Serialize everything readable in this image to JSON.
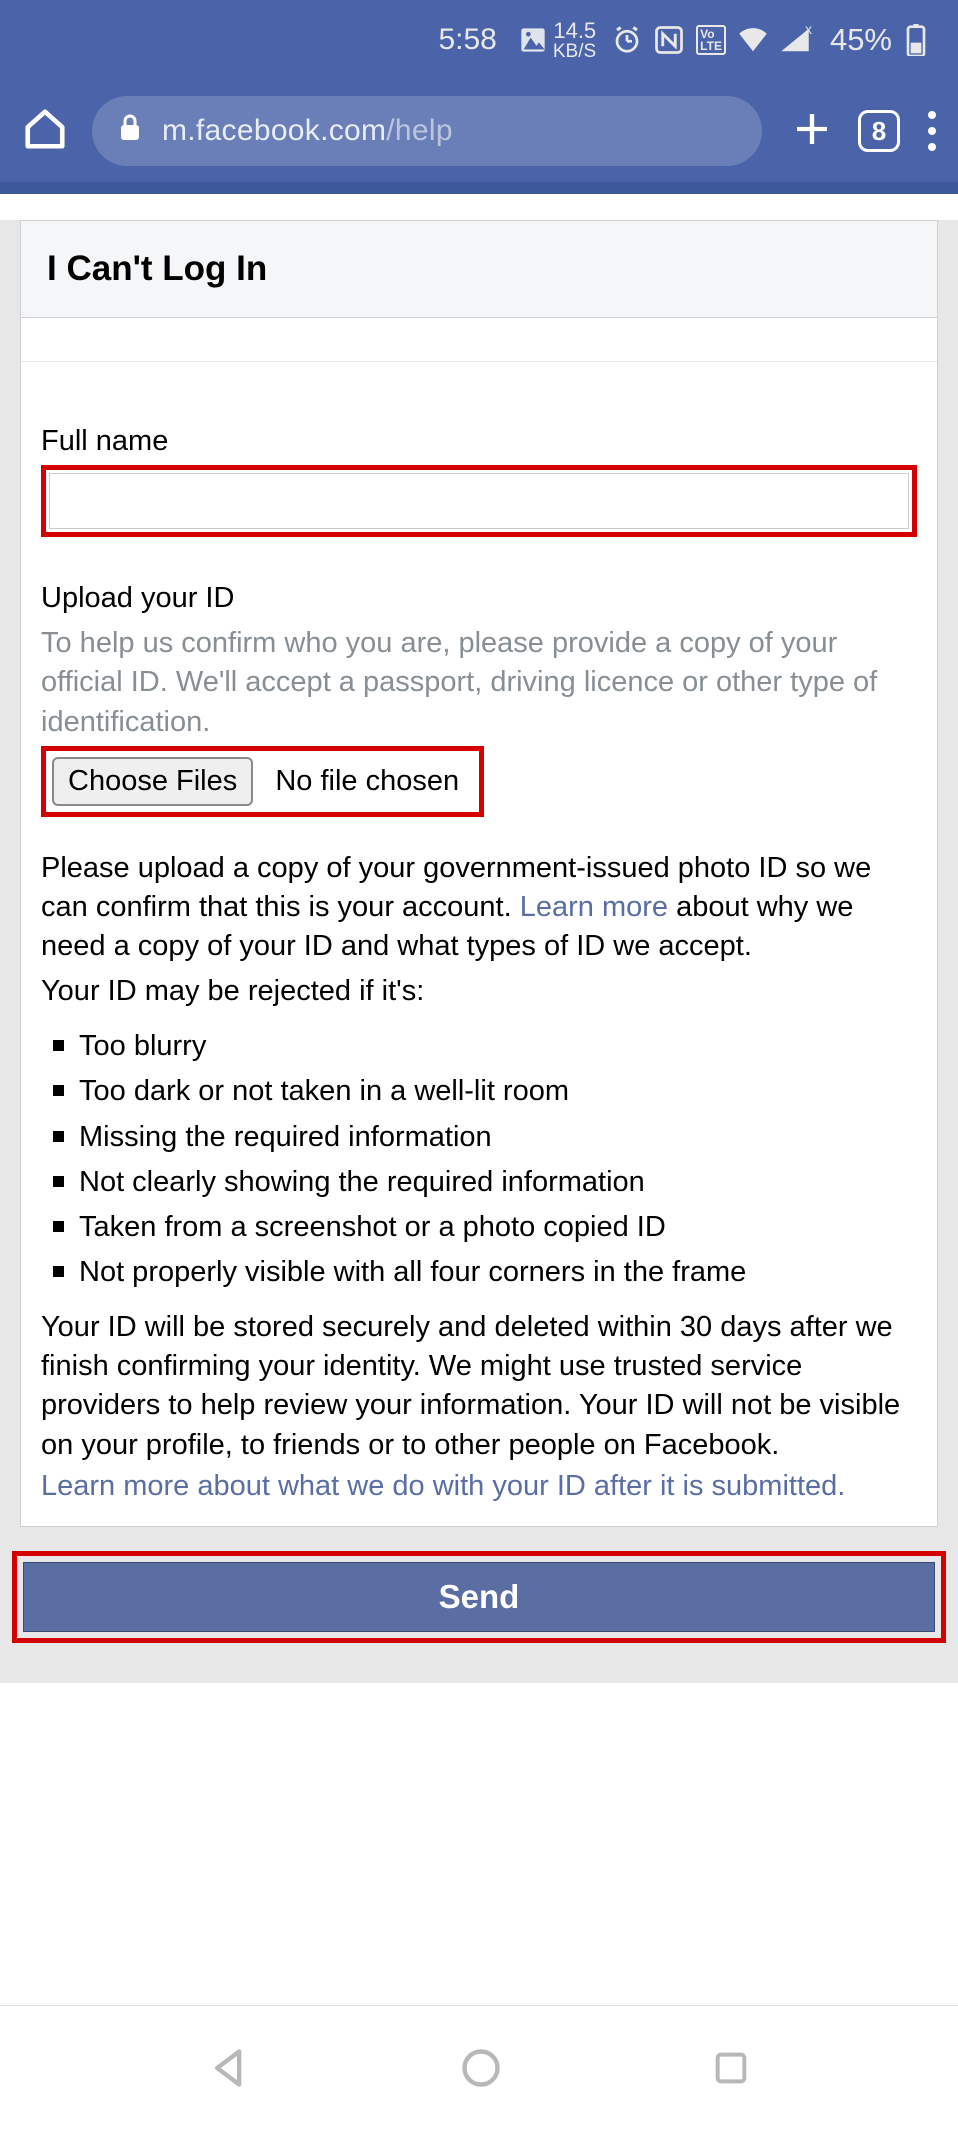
{
  "status_bar": {
    "time": "5:58",
    "kbs_top": "14.5",
    "kbs_bot": "KB/S",
    "volte": "Vo\nLTE",
    "battery_pct": "45%"
  },
  "toolbar": {
    "url_main": "m.facebook.com",
    "url_rest": "/help",
    "tab_count": "8"
  },
  "card": {
    "header": "I Can't Log In",
    "fullname_label": "Full name",
    "upload_label": "Upload your ID",
    "upload_help": "To help us confirm who you are, please provide a copy of your official ID. We'll accept a passport, driving licence or other type of identification.",
    "choose_files": "Choose Files",
    "no_file": "No file chosen",
    "para1_pre": "Please upload a copy of your government-issued photo ID so we can confirm that this is your account. ",
    "para1_link": "Learn more",
    "para1_post": " about why we need a copy of your ID and what types of ID we accept.",
    "rules_intro": "Your ID may be rejected if it's:",
    "rules": [
      "Too blurry",
      "Too dark or not taken in a well-lit room",
      "Missing the required information",
      "Not clearly showing the required information",
      "Taken from a screenshot or a photo copied ID",
      "Not properly visible with all four corners in the frame"
    ],
    "para2": "Your ID will be stored securely and deleted within 30 days after we finish confirming your identity. We might use trusted service providers to help review your information. Your ID will not be visible on your profile, to friends or to other people on Facebook.",
    "learn_more2": "Learn more about what we do with your ID after it is submitted.",
    "send": "Send"
  }
}
